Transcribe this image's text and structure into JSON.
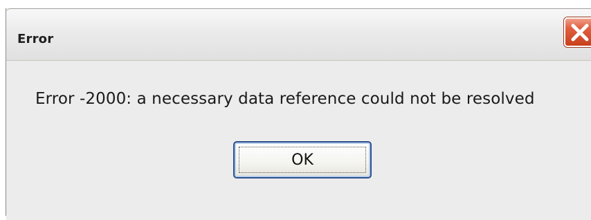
{
  "window": {
    "title": "Error",
    "close_icon": "close-icon"
  },
  "dialog": {
    "message": "Error -2000: a necessary data reference could not be resolved",
    "ok_label": "OK"
  },
  "colors": {
    "close_button": "#d9502f",
    "ok_border": "#2e4f8c",
    "dialog_background": "#ececec"
  }
}
